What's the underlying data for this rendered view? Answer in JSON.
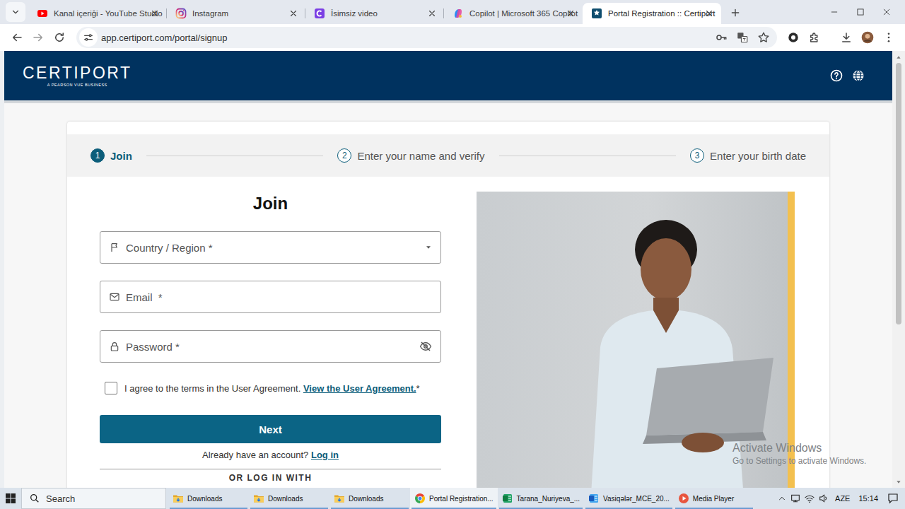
{
  "browser": {
    "tabs": [
      {
        "label": "Kanal içeriği - YouTube Studio",
        "kind": "youtube",
        "selected": false
      },
      {
        "label": "Instagram",
        "kind": "instagram",
        "selected": false
      },
      {
        "label": "İsimsiz video",
        "kind": "clipchamp",
        "selected": false
      },
      {
        "label": "Copilot | Microsoft 365 Copilot",
        "kind": "copilot",
        "selected": false
      },
      {
        "label": "Portal Registration :: Certiport",
        "kind": "certiport",
        "selected": true
      }
    ],
    "address": {
      "url": "app.certiport.com/portal/signup",
      "bookmarked": false
    }
  },
  "page": {
    "header": {
      "logo": "CERTIPORT",
      "tagline": "A PEARSON VUE BUSINESS"
    },
    "steps": [
      {
        "number": "1",
        "label": "Join",
        "selected": true
      },
      {
        "number": "2",
        "label": "Enter your name and verify",
        "selected": false
      },
      {
        "number": "3",
        "label": "Enter your birth date",
        "selected": false
      }
    ],
    "form": {
      "title": "Join",
      "fields": [
        {
          "kind": "select",
          "placeholder": "Country / Region *"
        },
        {
          "kind": "email",
          "placeholder": "Email  *"
        },
        {
          "kind": "password",
          "placeholder": "Password *"
        }
      ],
      "agreement": {
        "text": "I agree to the terms in the User Agreement.",
        "link": "View the User Agreement.",
        "required": "*",
        "checked": false
      },
      "next_button": "Next",
      "login_prompt": "Already have an account?",
      "login_link": "Log in",
      "alt_login": "OR LOG IN WITH"
    }
  },
  "watermark": {
    "title": "Activate Windows",
    "subtitle": "Go to Settings to activate Windows."
  },
  "taskbar": {
    "search": "Search",
    "items": [
      {
        "label": "Downloads",
        "kind": "folder",
        "selected": false
      },
      {
        "label": "Downloads",
        "kind": "folder",
        "selected": false
      },
      {
        "label": "Downloads",
        "kind": "folder",
        "selected": false
      },
      {
        "label": "Portal Registration...",
        "kind": "chrome",
        "selected": true
      },
      {
        "label": "Tarana_Nuriyeva_...",
        "kind": "excel",
        "selected": false
      },
      {
        "label": "Vasiqələr_MCE_20...",
        "kind": "word",
        "selected": false
      },
      {
        "label": "Media Player",
        "kind": "media",
        "selected": false
      }
    ],
    "tray": {
      "language": "AZE",
      "time": "15:14"
    }
  }
}
